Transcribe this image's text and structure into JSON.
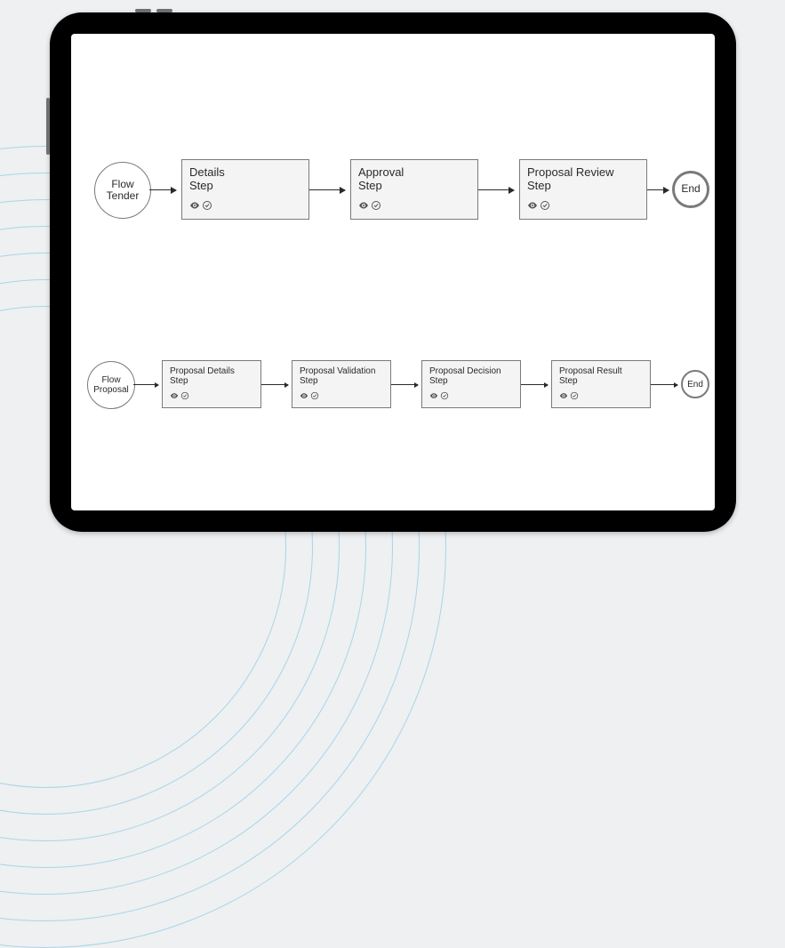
{
  "flow1": {
    "start_label": "Flow Tender",
    "steps": [
      {
        "line1": "Details",
        "line2": "Step"
      },
      {
        "line1": "Approval",
        "line2": "Step"
      },
      {
        "line1": "Proposal Review",
        "line2": "Step"
      }
    ],
    "end_label": "End"
  },
  "flow2": {
    "start_label": "Flow Proposal",
    "steps": [
      {
        "line1": "Proposal Details",
        "line2": "Step"
      },
      {
        "line1": "Proposal Validation",
        "line2": "Step"
      },
      {
        "line1": "Proposal Decision",
        "line2": "Step"
      },
      {
        "line1": "Proposal Result",
        "line2": "Step"
      }
    ],
    "end_label": "End"
  },
  "icons": {
    "eye": "eye-icon",
    "check": "check-circle-icon"
  }
}
